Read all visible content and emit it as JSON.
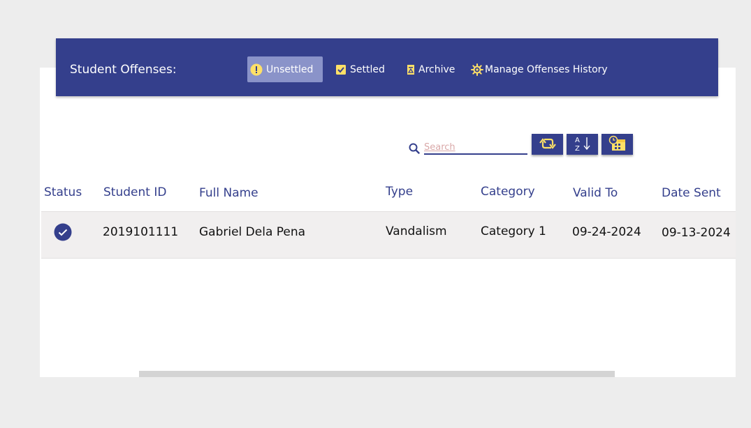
{
  "header": {
    "title": "Student Offenses:",
    "tabs": {
      "unsettled": "Unsettled",
      "settled": "Settled",
      "archive": "Archive",
      "manage": "Manage Offenses History"
    }
  },
  "search": {
    "placeholder": "Search",
    "value": ""
  },
  "toolbar": {
    "refresh_icon": "refresh-icon",
    "sort_icon": "sort-az-icon",
    "calendar_icon": "calendar-clock-icon"
  },
  "table": {
    "columns": [
      "Status",
      "Student ID",
      "Full Name",
      "Type",
      "Category",
      "Valid To",
      "Date Sent"
    ],
    "rows": [
      {
        "status": "check-circle-icon",
        "student_id": "2019101111",
        "full_name": "Gabriel Dela Pena",
        "type": "Vandalism",
        "category": "Category 1",
        "valid_to": "09-24-2024",
        "date_sent": "09-13-2024"
      }
    ]
  },
  "colors": {
    "primary": "#343f8c",
    "accent_yellow": "#ffe067",
    "active_tab": "#8a93c9",
    "row_bg": "#f1efef"
  }
}
